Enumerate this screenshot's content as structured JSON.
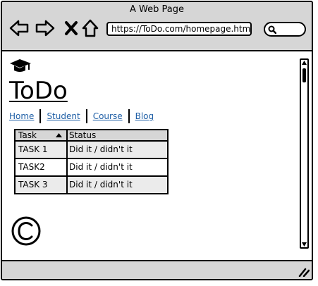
{
  "window": {
    "title": "A Web Page"
  },
  "toolbar": {
    "url": "https://ToDo.com/homepage.htm",
    "back_icon": "back-arrow-icon",
    "forward_icon": "forward-arrow-icon",
    "close_icon": "close-x-icon",
    "home_icon": "home-icon",
    "search_icon": "search-icon"
  },
  "page": {
    "logo_icon": "graduation-cap-icon",
    "title": "ToDo",
    "nav": [
      "Home",
      "Student",
      "Course",
      "Blog"
    ],
    "table": {
      "headers": {
        "task": "Task",
        "status": "Status"
      },
      "rows": [
        {
          "task": "TASK 1",
          "status": "Did it / didn't it"
        },
        {
          "task": "TASK2",
          "status": "Did it / didn't it"
        },
        {
          "task": "TASK 3",
          "status": "Did it / didn't it"
        }
      ],
      "sort_icon": "sort-ascending-icon"
    },
    "footer_icon": "copyright-icon"
  },
  "colors": {
    "chrome": "#d6d6d6",
    "link": "#1f5fa6",
    "row_alt": "#ebebeb"
  }
}
